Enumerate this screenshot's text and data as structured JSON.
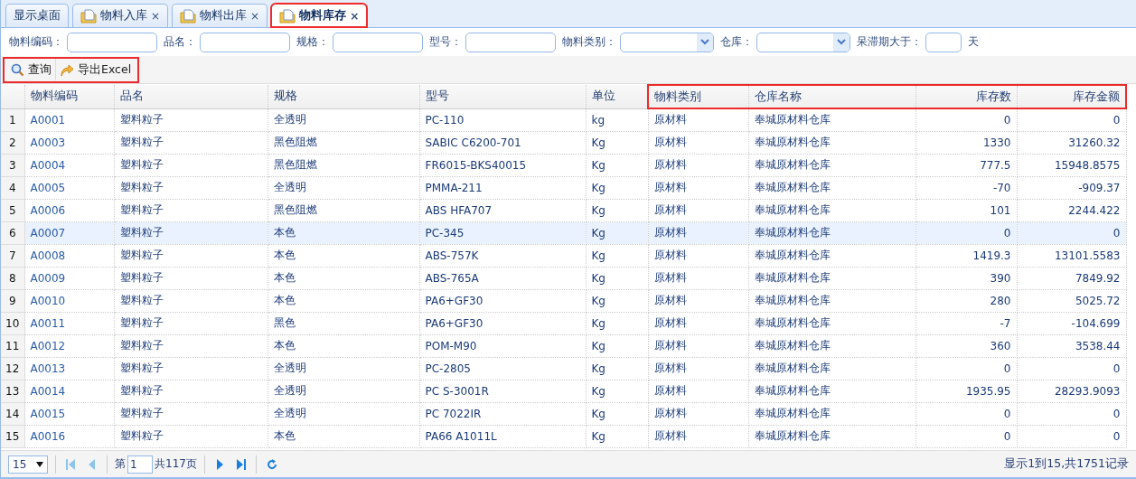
{
  "tabs": [
    {
      "label": "显示桌面",
      "kind": "home",
      "selected": false,
      "highlighted": false
    },
    {
      "label": "物料入库",
      "kind": "document",
      "selected": false,
      "highlighted": false
    },
    {
      "label": "物料出库",
      "kind": "document",
      "selected": false,
      "highlighted": false
    },
    {
      "label": "物料库存",
      "kind": "document",
      "selected": true,
      "highlighted": true
    }
  ],
  "tab_close": "×",
  "filters": [
    {
      "label": "物料编码：",
      "kind": "text"
    },
    {
      "label": "品名：",
      "kind": "text"
    },
    {
      "label": "规格：",
      "kind": "text"
    },
    {
      "label": "型号：",
      "kind": "text"
    },
    {
      "label": "物料类别：",
      "kind": "select"
    },
    {
      "label": "仓库：",
      "kind": "select"
    },
    {
      "label": "呆滞期大于：",
      "kind": "short",
      "suffix": "天"
    }
  ],
  "toolbar": {
    "highlighted": true,
    "buttons": [
      {
        "label": "查询",
        "kind": "search"
      },
      {
        "label": "导出Excel",
        "kind": "export"
      }
    ]
  },
  "table": {
    "columns": [
      {
        "label": "物料编码",
        "kind": "text",
        "highlighted": false
      },
      {
        "label": "品名",
        "kind": "text",
        "highlighted": false
      },
      {
        "label": "规格",
        "kind": "text",
        "highlighted": false
      },
      {
        "label": "型号",
        "kind": "text",
        "highlighted": false
      },
      {
        "label": "单位",
        "kind": "text",
        "highlighted": false
      },
      {
        "label": "物料类别",
        "kind": "text",
        "highlighted": true
      },
      {
        "label": "仓库名称",
        "kind": "text",
        "highlighted": true
      },
      {
        "label": "库存数",
        "kind": "number",
        "highlighted": true
      },
      {
        "label": "库存金额",
        "kind": "number",
        "highlighted": true
      }
    ],
    "rows": [
      {
        "num": "1",
        "selected": false,
        "cells": [
          "A0001",
          "塑料粒子",
          "全透明",
          "PC-110",
          "kg",
          "原材料",
          "奉城原材料仓库",
          "0",
          "0"
        ]
      },
      {
        "num": "2",
        "selected": false,
        "cells": [
          "A0003",
          "塑料粒子",
          "黑色阻燃",
          "SABIC C6200-701",
          "Kg",
          "原材料",
          "奉城原材料仓库",
          "1330",
          "31260.32"
        ]
      },
      {
        "num": "3",
        "selected": false,
        "cells": [
          "A0004",
          "塑料粒子",
          "黑色阻燃",
          "FR6015-BKS40015",
          "Kg",
          "原材料",
          "奉城原材料仓库",
          "777.5",
          "15948.8575"
        ]
      },
      {
        "num": "4",
        "selected": false,
        "cells": [
          "A0005",
          "塑料粒子",
          "全透明",
          "PMMA-211",
          "Kg",
          "原材料",
          "奉城原材料仓库",
          "-70",
          "-909.37"
        ]
      },
      {
        "num": "5",
        "selected": false,
        "cells": [
          "A0006",
          "塑料粒子",
          "黑色阻燃",
          "ABS HFA707",
          "Kg",
          "原材料",
          "奉城原材料仓库",
          "101",
          "2244.422"
        ]
      },
      {
        "num": "6",
        "selected": true,
        "cells": [
          "A0007",
          "塑料粒子",
          "本色",
          "PC-345",
          "Kg",
          "原材料",
          "奉城原材料仓库",
          "0",
          "0"
        ]
      },
      {
        "num": "7",
        "selected": false,
        "cells": [
          "A0008",
          "塑料粒子",
          "本色",
          "ABS-757K",
          "Kg",
          "原材料",
          "奉城原材料仓库",
          "1419.3",
          "13101.5583"
        ]
      },
      {
        "num": "8",
        "selected": false,
        "cells": [
          "A0009",
          "塑料粒子",
          "本色",
          "ABS-765A",
          "Kg",
          "原材料",
          "奉城原材料仓库",
          "390",
          "7849.92"
        ]
      },
      {
        "num": "9",
        "selected": false,
        "cells": [
          "A0010",
          "塑料粒子",
          "本色",
          "PA6+GF30",
          "Kg",
          "原材料",
          "奉城原材料仓库",
          "280",
          "5025.72"
        ]
      },
      {
        "num": "10",
        "selected": false,
        "cells": [
          "A0011",
          "塑料粒子",
          "黑色",
          "PA6+GF30",
          "Kg",
          "原材料",
          "奉城原材料仓库",
          "-7",
          "-104.699"
        ]
      },
      {
        "num": "11",
        "selected": false,
        "cells": [
          "A0012",
          "塑料粒子",
          "本色",
          "POM-M90",
          "Kg",
          "原材料",
          "奉城原材料仓库",
          "360",
          "3538.44"
        ]
      },
      {
        "num": "12",
        "selected": false,
        "cells": [
          "A0013",
          "塑料粒子",
          "全透明",
          "PC-2805",
          "Kg",
          "原材料",
          "奉城原材料仓库",
          "0",
          "0"
        ]
      },
      {
        "num": "13",
        "selected": false,
        "cells": [
          "A0014",
          "塑料粒子",
          "全透明",
          "PC S-3001R",
          "Kg",
          "原材料",
          "奉城原材料仓库",
          "1935.95",
          "28293.9093"
        ]
      },
      {
        "num": "14",
        "selected": false,
        "cells": [
          "A0015",
          "塑料粒子",
          "全透明",
          "PC 7022IR",
          "Kg",
          "原材料",
          "奉城原材料仓库",
          "0",
          "0"
        ]
      },
      {
        "num": "15",
        "selected": false,
        "cells": [
          "A0016",
          "塑料粒子",
          "本色",
          "PA66 A1011L",
          "Kg",
          "原材料",
          "奉城原材料仓库",
          "0",
          "0"
        ]
      }
    ]
  },
  "pager": {
    "page_size": "15",
    "page_prefix": "第",
    "page": "1",
    "page_suffix": "共117页",
    "first_disabled": true,
    "prev_disabled": true,
    "next_disabled": false,
    "last_disabled": false,
    "summary": "显示1到15,共1751记录"
  }
}
